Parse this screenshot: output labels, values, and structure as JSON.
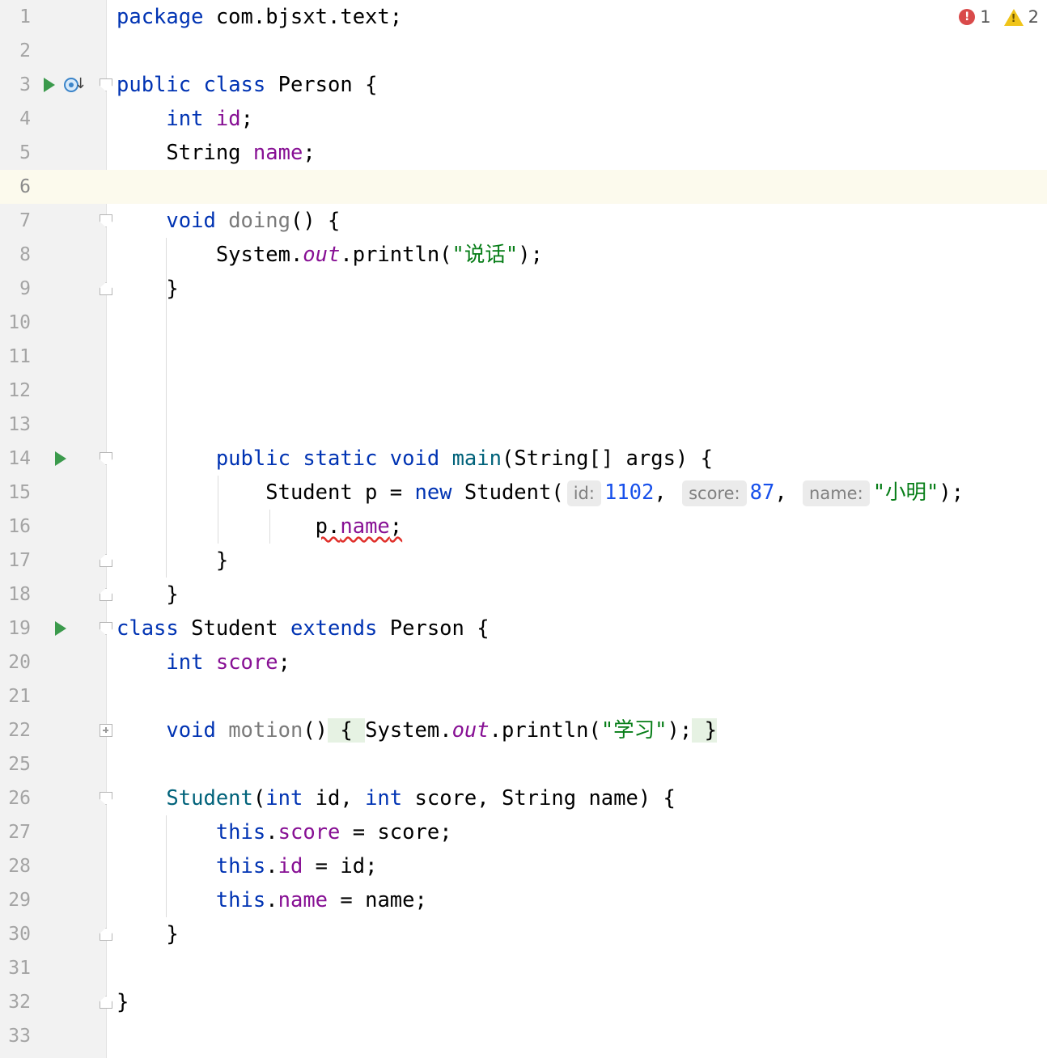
{
  "status": {
    "errors": "1",
    "warnings": "2"
  },
  "lines": [
    {
      "n": "1"
    },
    {
      "n": "2"
    },
    {
      "n": "3"
    },
    {
      "n": "4"
    },
    {
      "n": "5"
    },
    {
      "n": "6"
    },
    {
      "n": "7"
    },
    {
      "n": "8"
    },
    {
      "n": "9"
    },
    {
      "n": "10"
    },
    {
      "n": "11"
    },
    {
      "n": "12"
    },
    {
      "n": "13"
    },
    {
      "n": "14"
    },
    {
      "n": "15"
    },
    {
      "n": "16"
    },
    {
      "n": "17"
    },
    {
      "n": "18"
    },
    {
      "n": "19"
    },
    {
      "n": "20"
    },
    {
      "n": "21"
    },
    {
      "n": "22"
    },
    {
      "n": "25"
    },
    {
      "n": "26"
    },
    {
      "n": "27"
    },
    {
      "n": "28"
    },
    {
      "n": "29"
    },
    {
      "n": "30"
    },
    {
      "n": "31"
    },
    {
      "n": "32"
    },
    {
      "n": "33"
    }
  ],
  "code": {
    "package_kw": "package",
    "package_name": " com.bjsxt.text;",
    "public": "public",
    "class": "class",
    "person": " Person {",
    "int": "int",
    "id_field": "id",
    "string_type": "String ",
    "name_field": "name",
    "void": "void",
    "doing": "doing",
    "system": "System.",
    "out": "out",
    "println": ".println(",
    "str_shuohua": "\"说话\"",
    "static": "static",
    "main": "main",
    "main_args": "(String[] args) {",
    "student_decl": "Student p = ",
    "new": "new",
    "student_ctor": " Student(",
    "hint_id": "id:",
    "val_id": "1102",
    "hint_score": "score:",
    "val_score": "87",
    "hint_name": "name:",
    "str_xiaoming": "\"小明\"",
    "p_dot": "p.",
    "semicolon": ";",
    "student_class": " Student ",
    "extends": "extends",
    "person_brace": " Person {",
    "score_field": "score",
    "motion": "motion",
    "str_xuexi": "\"学习\"",
    "student_ctor_name": "Student",
    "this": "this",
    "close_brace": "}"
  }
}
